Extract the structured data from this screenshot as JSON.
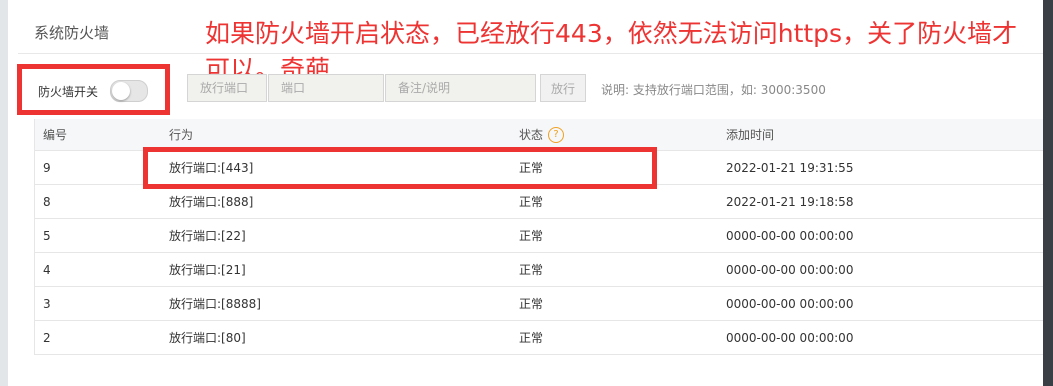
{
  "panel": {
    "title": "系统防火墙"
  },
  "annotation": {
    "text": "如果防火墙开启状态，已经放行443，依然无法访问https，关了防火墙才可以。奇葩"
  },
  "toolbar": {
    "switch_label": "防火墙开关",
    "switch_on": false,
    "port_placeholder": "放行端口",
    "port2_placeholder": "端口",
    "note_placeholder": "备注/说明",
    "allow_button": "放行",
    "hint": "说明: 支持放行端口范围，如: 3000:3500"
  },
  "table": {
    "headers": {
      "id": "编号",
      "action": "行为",
      "status": "状态",
      "added": "添加时间"
    },
    "rows": [
      {
        "id": "9",
        "action": "放行端口:[443]",
        "status": "正常",
        "added": "2022-01-21 19:31:55"
      },
      {
        "id": "8",
        "action": "放行端口:[888]",
        "status": "正常",
        "added": "2022-01-21 19:18:58"
      },
      {
        "id": "5",
        "action": "放行端口:[22]",
        "status": "正常",
        "added": "0000-00-00 00:00:00"
      },
      {
        "id": "4",
        "action": "放行端口:[21]",
        "status": "正常",
        "added": "0000-00-00 00:00:00"
      },
      {
        "id": "3",
        "action": "放行端口:[8888]",
        "status": "正常",
        "added": "0000-00-00 00:00:00"
      },
      {
        "id": "2",
        "action": "放行端口:[80]",
        "status": "正常",
        "added": "0000-00-00 00:00:00"
      }
    ]
  },
  "colors": {
    "annotation": "#ee3333",
    "help_icon": "#f0a020"
  }
}
